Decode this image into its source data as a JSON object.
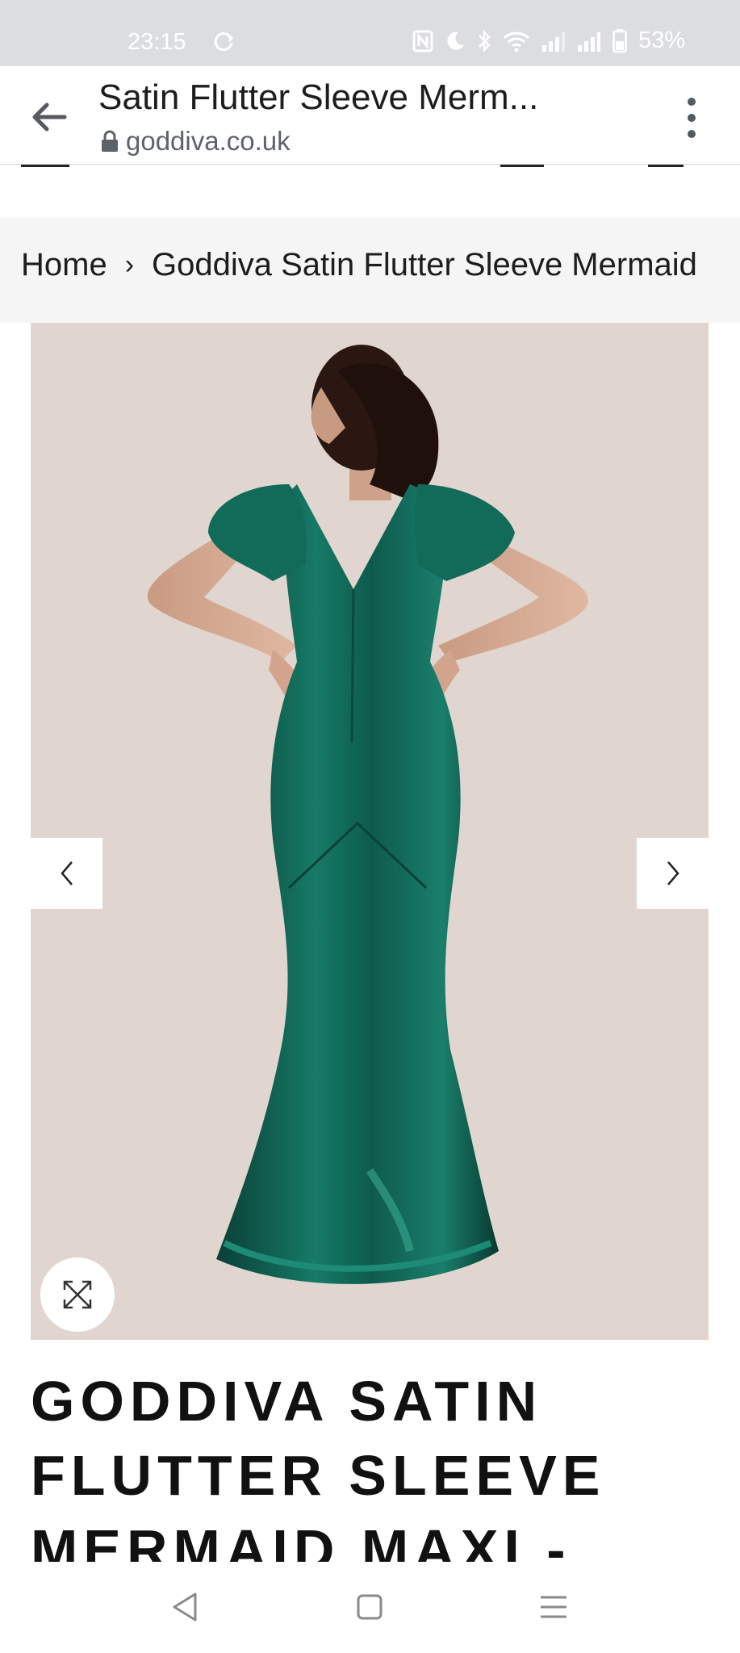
{
  "status_bar": {
    "time": "23:15",
    "battery": "53%"
  },
  "browser": {
    "page_title": "Satin Flutter Sleeve Merm...",
    "url": "goddiva.co.uk"
  },
  "breadcrumb": {
    "home": "Home",
    "separator": "›",
    "current": "Goddiva Satin Flutter Sleeve Mermaid"
  },
  "product": {
    "title": "GODDIVA SATIN FLUTTER SLEEVE MERMAID MAXI -",
    "image_alt": "Model wearing emerald green satin flutter sleeve mermaid maxi dress, back view",
    "dress_color": "#0f5a4c",
    "background_color": "#e1d6cf"
  },
  "icons": {
    "back": "back-arrow-icon",
    "menu": "more-vert-icon",
    "lock": "lock-icon",
    "prev": "chevron-left-icon",
    "next": "chevron-right-icon",
    "expand": "expand-icon"
  }
}
